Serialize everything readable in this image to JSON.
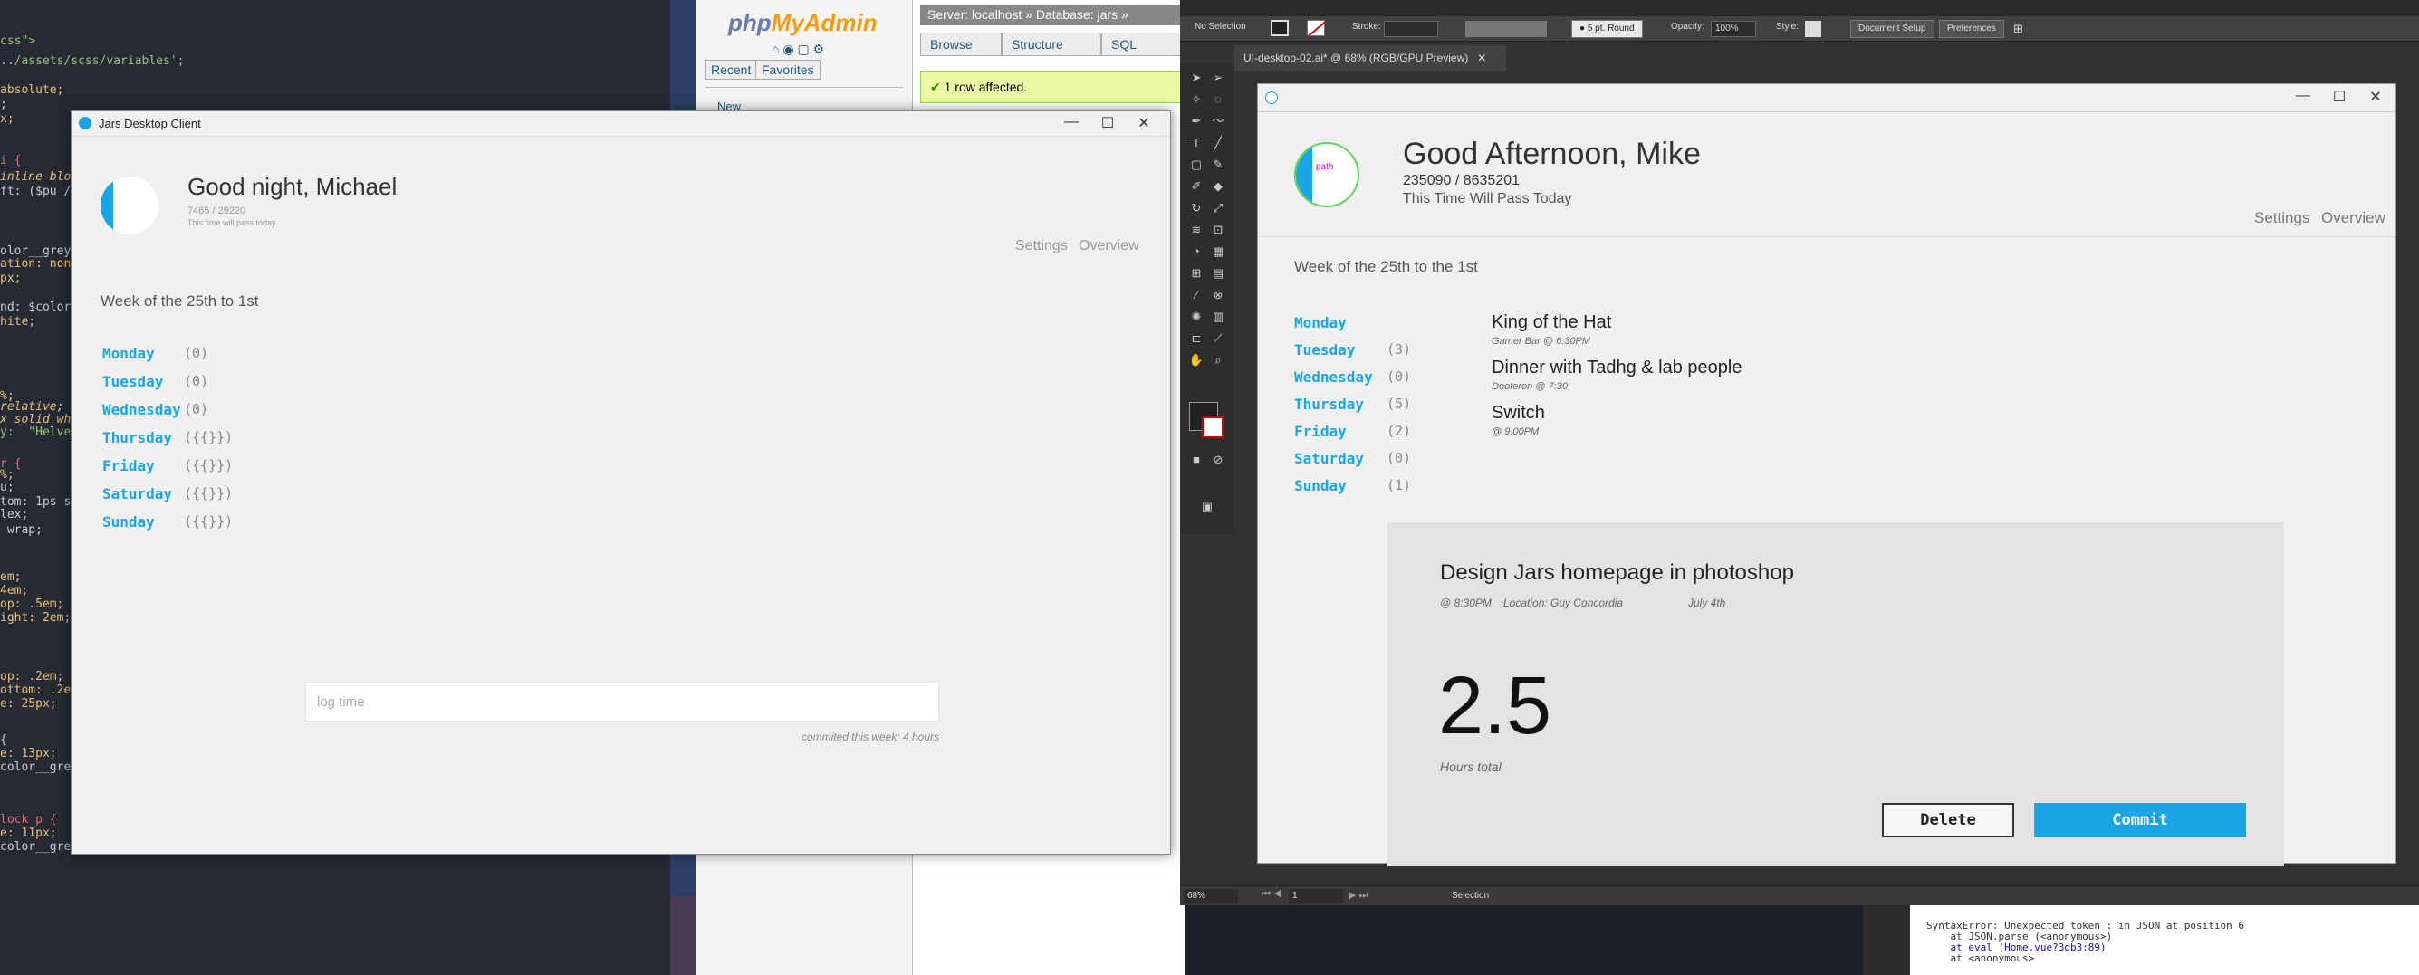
{
  "editor": {
    "lines": [
      {
        "t": "css\">",
        "c": "#98c379"
      },
      {
        "t": "../assets/scss/variables';",
        "c": "#98c379"
      },
      {
        "t": "absolute;",
        "c": "#e5c07b"
      },
      {
        "t": ";",
        "c": "#c8ccd4"
      },
      {
        "t": "x;",
        "c": "#e5c07b"
      },
      {
        "t": "i {",
        "c": "#e06c75"
      },
      {
        "t": "inline-block",
        "c": "#e5c07b",
        "it": true
      },
      {
        "t": "ft: ($pu /",
        "c": "#c8ccd4"
      },
      {
        "t": "olor__grey;",
        "c": "#c8ccd4"
      },
      {
        "t": "ation: none",
        "c": "#e5c07b"
      },
      {
        "t": "px;",
        "c": "#e5c07b"
      },
      {
        "t": "nd: $color_",
        "c": "#c8ccd4"
      },
      {
        "t": "hite;",
        "c": "#e5c07b"
      },
      {
        "t": "%;",
        "c": "#e5c07b"
      },
      {
        "t": "relative;",
        "c": "#e5c07b",
        "it": true
      },
      {
        "t": "x solid whi",
        "c": "#e5c07b",
        "it": true
      },
      {
        "t": "y:  \"Helvet",
        "c": "#98c379"
      },
      {
        "t": "r {",
        "c": "#e06c75"
      },
      {
        "t": "%;",
        "c": "#e5c07b"
      },
      {
        "t": "u;",
        "c": "#c8ccd4"
      },
      {
        "t": "tom: 1ps so",
        "c": "#c8ccd4"
      },
      {
        "t": "lex;",
        "c": "#c8ccd4"
      },
      {
        "t": " wrap;",
        "c": "#c8ccd4"
      },
      {
        "t": "em;",
        "c": "#e5c07b"
      },
      {
        "t": "4em;",
        "c": "#e5c07b"
      },
      {
        "t": "op: .5em;",
        "c": "#e5c07b"
      },
      {
        "t": "ight: 2em;",
        "c": "#e5c07b"
      },
      {
        "t": "op: .2em;",
        "c": "#e5c07b"
      },
      {
        "t": "ottom: .2em",
        "c": "#e5c07b"
      },
      {
        "t": "e: 25px;",
        "c": "#e5c07b"
      },
      {
        "t": "{",
        "c": "#c8ccd4"
      },
      {
        "t": "e: 13px;",
        "c": "#e5c07b"
      },
      {
        "t": "color__grey",
        "c": "#c8ccd4"
      },
      {
        "t": "lock p {",
        "c": "#e06c75"
      },
      {
        "t": "e: 11px;",
        "c": "#e5c07b"
      },
      {
        "t": "color__grey;",
        "c": "#c8ccd4"
      }
    ]
  },
  "pma": {
    "logo_a": "php",
    "logo_b": "MyAdmin",
    "recent": "Recent",
    "favorites": "Favorites",
    "new": "New",
    "breadcrumb": "Server: localhost » Database: jars »",
    "tab_browse": "Browse",
    "tab_structure": "Structure",
    "tab_sql": "SQL",
    "message": "1 row affected."
  },
  "jars_left": {
    "window_title": "Jars Desktop Client",
    "greeting": "Good night, Michael",
    "stats": "7465 / 29220",
    "tagline": "This time will pass today",
    "settings": "Settings",
    "overview": "Overview",
    "week": "Week of the 25th to 1st",
    "days": [
      {
        "name": "Monday",
        "count": "(0)"
      },
      {
        "name": "Tuesday",
        "count": "(0)"
      },
      {
        "name": "Wednesday",
        "count": "(0)"
      },
      {
        "name": "Thursday",
        "count": "({{}})"
      },
      {
        "name": "Friday",
        "count": "({{}})"
      },
      {
        "name": "Saturday",
        "count": "({{}})"
      },
      {
        "name": "Sunday",
        "count": "({{}})"
      }
    ],
    "log_placeholder": "log time",
    "commited": "commited this week: 4 hours"
  },
  "illustrator": {
    "no_selection": "No Selection",
    "stroke": "Stroke:",
    "brush": "5 pt. Round",
    "opacity_label": "Opacity:",
    "opacity": "100%",
    "style": "Style:",
    "doc_setup": "Document Setup",
    "preferences": "Preferences",
    "doc_tab": "UI-desktop-02.ai* @ 68% (RGB/GPU Preview)",
    "zoom": "68%",
    "page": "1",
    "status_mode": "Selection"
  },
  "mockup": {
    "logo_label": "path",
    "greeting": "Good Afternoon, Mike",
    "stats": "235090 / 8635201",
    "tagline": "This Time Will Pass Today",
    "settings": "Settings",
    "overview": "Overview",
    "week": "Week of the 25th to the 1st",
    "days": [
      {
        "name": "Monday",
        "count": ""
      },
      {
        "name": "Tuesday",
        "count": "(3)"
      },
      {
        "name": "Wednesday",
        "count": "(0)"
      },
      {
        "name": "Thursday",
        "count": "(5)"
      },
      {
        "name": "Friday",
        "count": "(2)"
      },
      {
        "name": "Saturday",
        "count": "(0)"
      },
      {
        "name": "Sunday",
        "count": "(1)"
      }
    ],
    "events": [
      {
        "title": "King of the Hat",
        "sub": "Gamer Bar @ 6:30PM"
      },
      {
        "title": "Dinner with Tadhg & lab people",
        "sub": "Dooteron @ 7:30"
      },
      {
        "title": "Switch",
        "sub": "@ 9:00PM"
      }
    ],
    "card": {
      "title": "Design Jars homepage in photoshop",
      "time": "@ 8:30PM",
      "location": "Location: Guy Concordia",
      "date": "July 4th",
      "hours": "2.5",
      "hours_label": "Hours total",
      "delete": "Delete",
      "commit": "Commit"
    }
  },
  "devtools": {
    "lines": [
      "SyntaxError: Unexpected token : in JSON at position 6",
      "    at JSON.parse (<anonymous>)",
      "    at eval (Home.vue?3db3:89)",
      "    at <anonymous>"
    ]
  }
}
